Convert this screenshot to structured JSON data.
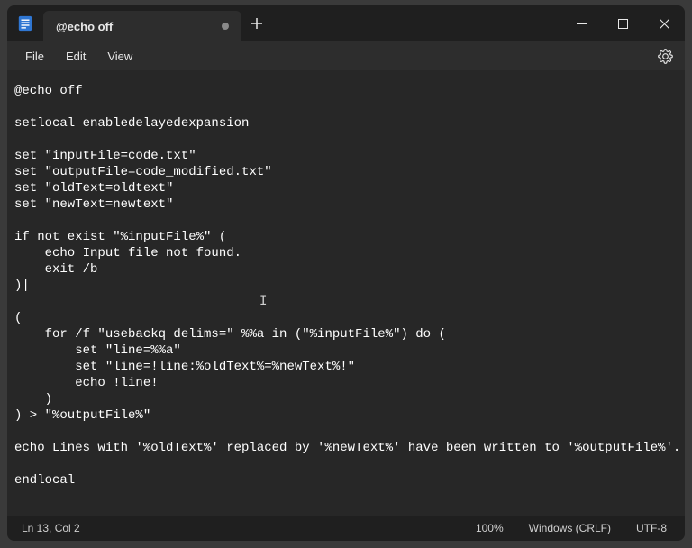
{
  "titlebar": {
    "tab": {
      "title": "@echo off",
      "dirty": true
    },
    "new_tab_tooltip": "New tab"
  },
  "menu": {
    "file": "File",
    "edit": "Edit",
    "view": "View"
  },
  "editor": {
    "content": "@echo off\n\nsetlocal enabledelayedexpansion\n\nset \"inputFile=code.txt\"\nset \"outputFile=code_modified.txt\"\nset \"oldText=oldtext\"\nset \"newText=newtext\"\n\nif not exist \"%inputFile%\" (\n    echo Input file not found.\n    exit /b\n)|\n\n(\n    for /f \"usebackq delims=\" %%a in (\"%inputFile%\") do (\n        set \"line=%%a\"\n        set \"line=!line:%oldText%=%newText%!\"\n        echo !line!\n    )\n) > \"%outputFile%\"\n\necho Lines with '%oldText%' replaced by '%newText%' have been written to '%outputFile%'.\n\nendlocal"
  },
  "status": {
    "caret": "Ln 13, Col 2",
    "zoom": "100%",
    "eol": "Windows (CRLF)",
    "encoding": "UTF-8"
  }
}
